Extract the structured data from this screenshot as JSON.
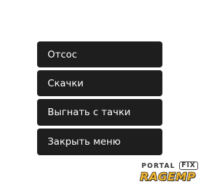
{
  "menu": {
    "items": [
      {
        "label": "Отсос"
      },
      {
        "label": "Скачки"
      },
      {
        "label": "Выгнать с тачки"
      },
      {
        "label": "Закрыть меню"
      }
    ]
  },
  "watermark": {
    "portal": "PORTAL",
    "fix": "FIX",
    "brand": "RAGEMP",
    "brand_color": "#f2b52e"
  }
}
